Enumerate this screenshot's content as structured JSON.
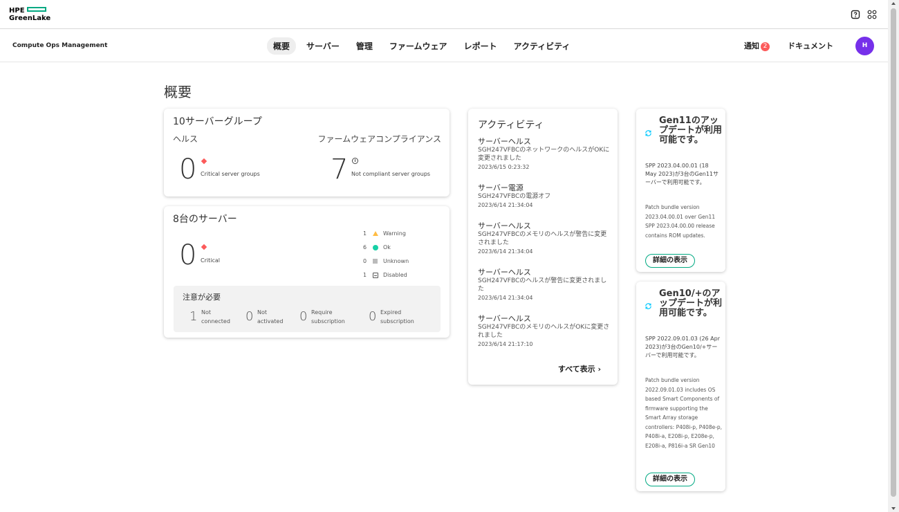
{
  "brand": {
    "line1": "HPE",
    "line2": "GreenLake",
    "accent": "#01a982"
  },
  "app": {
    "name": "Compute Ops Management"
  },
  "nav": {
    "tabs": [
      {
        "label": "概要",
        "active": true
      },
      {
        "label": "サーバー"
      },
      {
        "label": "管理"
      },
      {
        "label": "ファームウェア"
      },
      {
        "label": "レポート"
      },
      {
        "label": "アクティビティ"
      }
    ],
    "notifications_label": "通知",
    "notifications_count": "2",
    "docs_label": "ドキュメント",
    "avatar_initial": "H",
    "avatar_color": "#7630ea"
  },
  "page": {
    "title": "概要"
  },
  "server_groups": {
    "title": "10サーバーグループ",
    "health_label": "ヘルス",
    "compliance_label": "ファームウェアコンプライアンス",
    "critical_count": "0",
    "critical_label": "Critical server groups",
    "noncompliant_count": "7",
    "noncompliant_label": "Not compliant server groups"
  },
  "servers": {
    "title": "8台のサーバー",
    "critical_count": "0",
    "critical_label": "Critical",
    "statuses": [
      {
        "count": "1",
        "label": "Warning",
        "icon": "warning-icon"
      },
      {
        "count": "6",
        "label": "Ok",
        "icon": "ok-icon"
      },
      {
        "count": "0",
        "label": "Unknown",
        "icon": "unknown-icon"
      },
      {
        "count": "1",
        "label": "Disabled",
        "icon": "disabled-icon"
      }
    ],
    "attention": {
      "title": "注意が必要",
      "items": [
        {
          "count": "1",
          "line1": "Not",
          "line2": "connected"
        },
        {
          "count": "0",
          "line1": "Not",
          "line2": "activated"
        },
        {
          "count": "0",
          "line1": "Require",
          "line2": "subscription"
        },
        {
          "count": "0",
          "line1": "Expired",
          "line2": "subscription"
        }
      ]
    }
  },
  "activity": {
    "title": "アクティビティ",
    "items": [
      {
        "title": "サーバーヘルス",
        "desc": "SGH247VFBCのネットワークのヘルスがOKに変更されました",
        "time": "2023/6/15 0:23:32"
      },
      {
        "title": "サーバー電源",
        "desc": "SGH247VFBCの電源オフ",
        "time": "2023/6/14 21:34:04"
      },
      {
        "title": "サーバーヘルス",
        "desc": "SGH247VFBCのメモリのヘルスが警告に変更されました",
        "time": "2023/6/14 21:34:04"
      },
      {
        "title": "サーバーヘルス",
        "desc": "SGH247VFBCのヘルスが警告に変更されました",
        "time": "2023/6/14 21:34:04"
      },
      {
        "title": "サーバーヘルス",
        "desc": "SGH247VFBCのメモリのヘルスがOKに変更されました",
        "time": "2023/6/14 21:17:10"
      }
    ],
    "show_all": "すべて表示 ›"
  },
  "updates": [
    {
      "title": "Gen11のアップデートが利用可能です。",
      "summary": "SPP 2023.04.00.01 (18 May 2023)が3台のGen11サーバーで利用可能です。",
      "note": "Patch bundle version 2023.04.00.01 over Gen11 SPP 2023.04.00.00 release contains ROM updates.",
      "button": "詳細の表示"
    },
    {
      "title": "Gen10/+のアップデートが利用可能です。",
      "summary": "SPP 2022.09.01.03 (26 Apr 2023)が3台のGen10/+サーバーで利用可能です。",
      "note": "Patch bundle version 2022.09.01.03 includes OS based Smart Components of firmware supporting the Smart Array storage controllers: P408i-p, P408e-p, P408i-a, E208i-p, E208e-p, E208i-a, P816i-a SR Gen10",
      "button": "詳細の表示"
    }
  ]
}
